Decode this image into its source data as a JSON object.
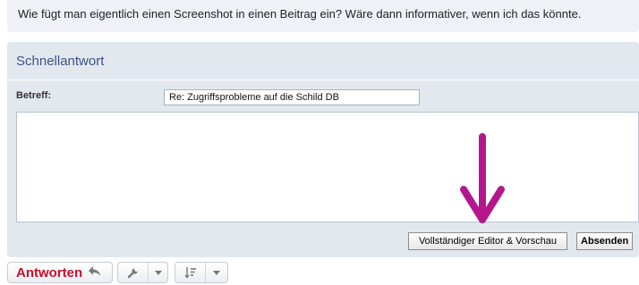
{
  "post": {
    "text": "Wie fügt man eigentlich einen Screenshot in einen Beitrag ein? Wäre dann informativer, wenn ich das könnte."
  },
  "quick_reply": {
    "title": "Schnellantwort",
    "subject_label": "Betreff:",
    "subject_value": "Re: Zugriffsprobleme auf die Schild DB",
    "message_value": "",
    "editor_button_label": "Vollständiger Editor & Vorschau",
    "send_button_label": "Absenden"
  },
  "annotation": {
    "arrow_color": "#b5168e",
    "arrow_icon": "down-arrow"
  },
  "toolbar": {
    "reply_label": "Antworten",
    "reply_icon": "reply-arrow-icon",
    "tools_icon": "wrench-icon",
    "sort_icon": "sort-order-icon",
    "dropdown_icon": "chevron-down-icon"
  },
  "colors": {
    "panel_bg": "#e3e8ef",
    "title_color": "#3c5386",
    "reply_color": "#c8102e"
  }
}
